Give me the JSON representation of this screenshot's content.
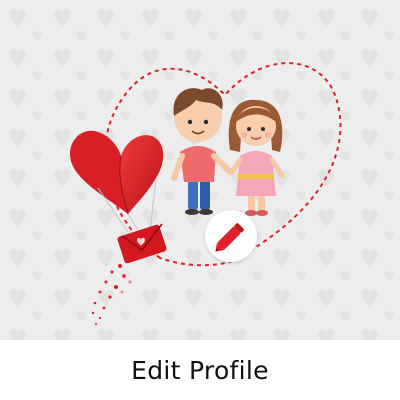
{
  "screen": {
    "title": "Edit Profile",
    "background_color": "#ededed",
    "accent_color": "#e0202b"
  },
  "illustration": {
    "subject": "couple-holding-hands",
    "frame_icon": "heart-outline-dashed-icon",
    "balloon_icon": "heart-balloon-icon",
    "envelope_icon": "love-letter-icon"
  },
  "edit_button": {
    "icon": "pencil-icon"
  }
}
